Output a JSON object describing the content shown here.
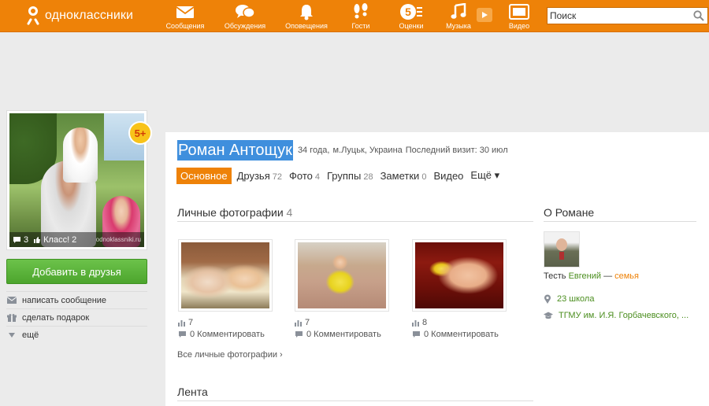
{
  "brand": {
    "logo_text": "одноклассники",
    "accent": "#ee8208"
  },
  "nav": {
    "messages": "Сообщения",
    "discussions": "Обсуждения",
    "alerts": "Оповещения",
    "guests": "Гости",
    "marks": "Оценки",
    "music": "Музыка",
    "video": "Видео"
  },
  "search": {
    "placeholder": "Поиск"
  },
  "avatar": {
    "comments": "3",
    "class_label": "Класс! 2",
    "watermark": "odnoklassniki.ru",
    "badge": "5+"
  },
  "actions": {
    "add_friend": "Добавить в друзья",
    "write_message": "написать сообщение",
    "make_gift": "сделать подарок",
    "more": "ещё"
  },
  "profile": {
    "name": "Роман Антощук",
    "age": "34 года,",
    "location": "м.Луцьк, Украина",
    "last_visit": "Последний визит: 30 июл"
  },
  "tabs": [
    {
      "label": "Основное",
      "count": ""
    },
    {
      "label": "Друзья",
      "count": "72"
    },
    {
      "label": "Фото",
      "count": "4"
    },
    {
      "label": "Группы",
      "count": "28"
    },
    {
      "label": "Заметки",
      "count": "0"
    },
    {
      "label": "Видео",
      "count": ""
    },
    {
      "label": "Ещё ▾",
      "count": ""
    }
  ],
  "photos": {
    "title": "Личные фотографии",
    "count": "4",
    "items": [
      {
        "views": "7",
        "comments": "0 Комментировать"
      },
      {
        "views": "7",
        "comments": "0 Комментировать"
      },
      {
        "views": "8",
        "comments": "0 Комментировать"
      }
    ],
    "all_link": "Все личные фотографии ›"
  },
  "feed": {
    "title": "Лента"
  },
  "about": {
    "title": "О Романе",
    "relative_prefix": "Тесть",
    "relative_name": "Евгений",
    "relative_dash": "—",
    "relative_group": "семья",
    "school": "23 школа",
    "university": "ТГМУ им. И.Я. Горбачевского, ..."
  }
}
